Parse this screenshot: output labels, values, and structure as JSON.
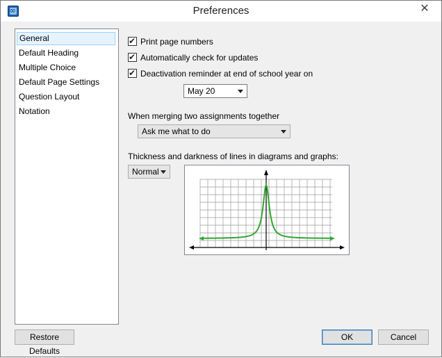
{
  "window": {
    "title": "Preferences",
    "close_glyph": "✕"
  },
  "sidebar": {
    "items": [
      {
        "label": "General",
        "selected": true
      },
      {
        "label": "Default Heading",
        "selected": false
      },
      {
        "label": "Multiple Choice",
        "selected": false
      },
      {
        "label": "Default Page Settings",
        "selected": false
      },
      {
        "label": "Question Layout",
        "selected": false
      },
      {
        "label": "Notation",
        "selected": false
      }
    ]
  },
  "general": {
    "print_page_numbers": {
      "label": "Print page numbers",
      "checked": true
    },
    "auto_check_updates": {
      "label": "Automatically check for updates",
      "checked": true
    },
    "deactivation_reminder": {
      "label": "Deactivation reminder at end of school year on",
      "checked": true
    },
    "reminder_date": {
      "value": "May 20"
    },
    "merge_label": "When merging two assignments together",
    "merge_option": {
      "value": "Ask me what to do"
    },
    "thickness_label": "Thickness and darkness of lines in diagrams and graphs:",
    "thickness_option": {
      "value": "Normal"
    }
  },
  "buttons": {
    "restore_defaults": "Restore Defaults",
    "ok": "OK",
    "cancel": "Cancel"
  },
  "colors": {
    "curve": "#2ea82e",
    "grid": "#9a9a9a",
    "axis": "#000000",
    "selection_bg": "#e5f3ff"
  },
  "icons": {
    "app": "app-logo-icon",
    "close": "close-icon",
    "dropdown": "chevron-down-icon",
    "check": "checkmark-icon"
  }
}
